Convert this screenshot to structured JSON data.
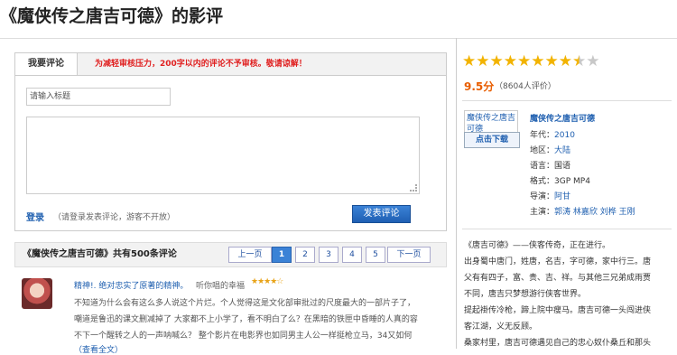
{
  "page": {
    "title": "《魔侠传之唐吉可德》的影评"
  },
  "review_form": {
    "tab_label": "我要评论",
    "notice": "为减轻审核压力，200字以内的评论不予审核。敬请谅解！",
    "title_placeholder": "请输入标题",
    "login_label": "登录",
    "login_hint": "（请登录发表评论，游客不开放）",
    "submit_label": "发表评论"
  },
  "review_list": {
    "header": "《魔侠传之唐吉可德》共有500条评论",
    "pagination": {
      "prev": "上一页",
      "pages": [
        "1",
        "2",
        "3",
        "4",
        "5"
      ],
      "active": "1",
      "next": "下一页"
    },
    "reviews": [
      {
        "title": "精神!. 绝对忠实了原著的精神。",
        "user": "听你唱的幸福",
        "stars": "★★★★☆",
        "lines": [
          "不知道为什么会有这么多人说这个片烂。个人觉得这是文化部审批过的尺度最大的一部片子了，",
          "嘲道是鲁迅的课文删减掉了 大家都不上小学了，看不明白了么？在黑暗的铁匣中昏睡的人真的容",
          "不下一个醒转之人的一声呐喊么？ 整个影片在电影界也如同男主人公一样挺枪立马，34又如何"
        ],
        "more": "（查看全文）"
      }
    ]
  },
  "film": {
    "rating_stars": [
      "on",
      "on",
      "on",
      "on",
      "on",
      "on",
      "on",
      "on",
      "half",
      "off"
    ],
    "score": "9.5分",
    "votes": "（8604人评价）",
    "poster_caption": "魔侠传之唐吉可德",
    "download_label": "点击下载",
    "name": "魔侠传之唐吉可德",
    "info": [
      {
        "label": "年代：",
        "value": "2010"
      },
      {
        "label": "地区：",
        "value": "大陆"
      },
      {
        "label": "语言：",
        "value": "国语"
      },
      {
        "label": "格式：",
        "value": "3GP MP4"
      },
      {
        "label": "导演：",
        "value": "阿甘"
      },
      {
        "label": "主演：",
        "value": "郭涛  林嘉欣  刘桦  王刚"
      }
    ],
    "synopsis": [
      "《唐吉可德》——侠客传奇，正在进行。",
      "出身蜀中唐门，姓唐，名吉，字可德，家中行三。唐",
      "父有有四子，富、贵、吉、祥。与其他三兄弟成雨贾",
      "不同，唐吉只梦想游行侠客世界。",
      "提起褂传冷枪，蹄上院中瘦马。唐吉可德一头闯进侠",
      "客江湖，义无反顾。",
      "桑家村里，唐吉可德遇见自己的忠心奴仆桑丘和那头"
    ]
  }
}
